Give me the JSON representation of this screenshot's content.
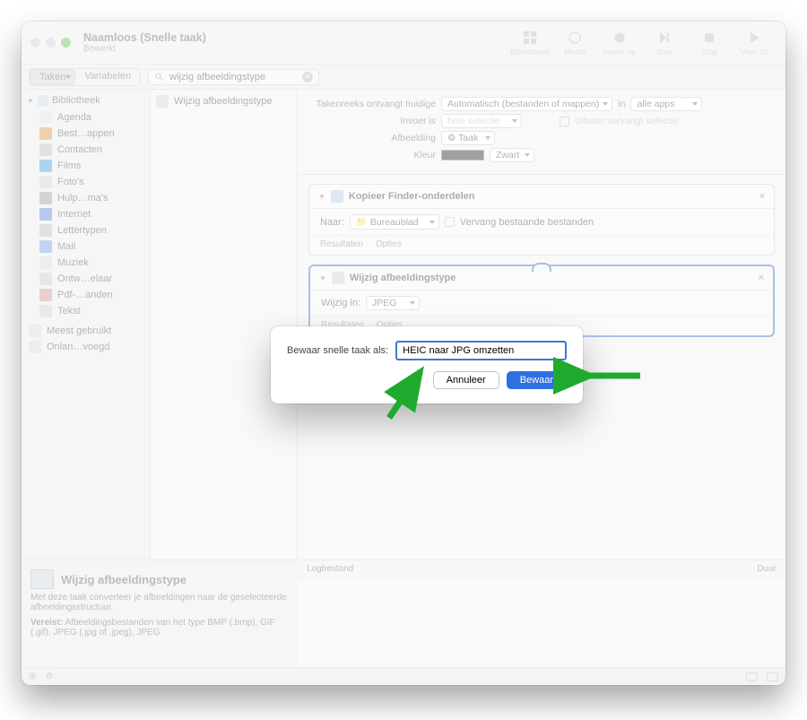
{
  "window": {
    "title": "Naamloos (Snelle taak)",
    "subtitle": "Bewerkt"
  },
  "toolbar": {
    "library": "Bibliotheek",
    "media": "Media",
    "record": "Neem op",
    "step": "Stap",
    "stop": "Stop",
    "run": "Voer uit"
  },
  "subbar": {
    "actions_tab": "Taken",
    "variables_tab": "Variabelen",
    "search_value": "wijzig afbeeldingstype"
  },
  "sidebar": {
    "header": "Bibliotheek",
    "items": [
      {
        "label": "Agenda"
      },
      {
        "label": "Best…appen"
      },
      {
        "label": "Contacten"
      },
      {
        "label": "Films"
      },
      {
        "label": "Foto's"
      },
      {
        "label": "Hulp…ma's"
      },
      {
        "label": "Internet"
      },
      {
        "label": "Lettertypen"
      },
      {
        "label": "Mail"
      },
      {
        "label": "Muziek"
      },
      {
        "label": "Ontw…elaar"
      },
      {
        "label": "Pdf-…anden"
      },
      {
        "label": "Tekst"
      }
    ],
    "extra": [
      {
        "label": "Meest gebruikt"
      },
      {
        "label": "Onlan…voegd"
      }
    ]
  },
  "midlist": {
    "item": "Wijzig afbeeldingstype"
  },
  "flowhdr": {
    "l1": "Takenreeks ontvangt huidige",
    "v1": "Automatisch (bestanden of mappen)",
    "in": "in",
    "v1b": "alle apps",
    "l2": "Invoer is",
    "v2": "hele selectie",
    "chk2": "Uitvoer vervangt selectie",
    "l3": "Afbeelding",
    "v3": "Taak",
    "l4": "Kleur",
    "v4": "Zwart"
  },
  "actions": {
    "copy": {
      "title": "Kopieer Finder-onderdelen",
      "naar": "Naar:",
      "dest": "Bureaublad",
      "repl": "Vervang bestaande bestanden",
      "res": "Resultaten",
      "opt": "Opties"
    },
    "convert": {
      "title": "Wijzig afbeeldingstype",
      "to": "Wijzig in:",
      "fmt": "JPEG",
      "res": "Resultaten",
      "opt": "Opties"
    }
  },
  "log": {
    "col1": "Logbestand",
    "col2": "Duur"
  },
  "info": {
    "title": "Wijzig afbeeldingstype",
    "desc": "Met deze taak converteer je afbeeldingen naar de geselecteerde afbeeldingsstructuur.",
    "req_l": "Vereist:",
    "req": "Afbeeldingsbestanden van het type BMP (.bmp), GIF (.gif), JPEG (.jpg of .jpeg), JPEG"
  },
  "modal": {
    "label": "Bewaar snelle taak als:",
    "value": "HEIC naar JPG omzetten",
    "cancel": "Annuleer",
    "save": "Bewaar"
  }
}
